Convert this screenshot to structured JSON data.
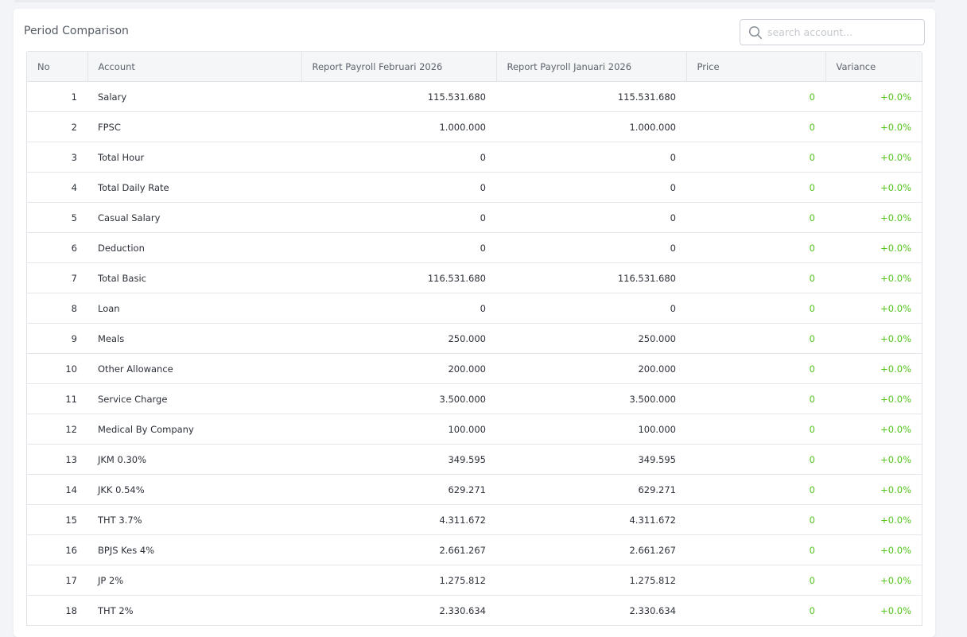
{
  "card": {
    "title": "Period Comparison"
  },
  "search": {
    "placeholder": "search account..."
  },
  "table": {
    "headers": {
      "no": "No",
      "account": "Account",
      "period_a": "Report Payroll Februari 2026",
      "period_b": "Report Payroll Januari 2026",
      "price": "Price",
      "variance": "Variance"
    },
    "rows": [
      {
        "no": "1",
        "account": "Salary",
        "period_a": "115.531.680",
        "period_b": "115.531.680",
        "price": "0",
        "variance": "+0.0%"
      },
      {
        "no": "2",
        "account": "FPSC",
        "period_a": "1.000.000",
        "period_b": "1.000.000",
        "price": "0",
        "variance": "+0.0%"
      },
      {
        "no": "3",
        "account": "Total Hour",
        "period_a": "0",
        "period_b": "0",
        "price": "0",
        "variance": "+0.0%"
      },
      {
        "no": "4",
        "account": "Total Daily Rate",
        "period_a": "0",
        "period_b": "0",
        "price": "0",
        "variance": "+0.0%"
      },
      {
        "no": "5",
        "account": "Casual Salary",
        "period_a": "0",
        "period_b": "0",
        "price": "0",
        "variance": "+0.0%"
      },
      {
        "no": "6",
        "account": "Deduction",
        "period_a": "0",
        "period_b": "0",
        "price": "0",
        "variance": "+0.0%"
      },
      {
        "no": "7",
        "account": "Total Basic",
        "period_a": "116.531.680",
        "period_b": "116.531.680",
        "price": "0",
        "variance": "+0.0%"
      },
      {
        "no": "8",
        "account": "Loan",
        "period_a": "0",
        "period_b": "0",
        "price": "0",
        "variance": "+0.0%"
      },
      {
        "no": "9",
        "account": "Meals",
        "period_a": "250.000",
        "period_b": "250.000",
        "price": "0",
        "variance": "+0.0%"
      },
      {
        "no": "10",
        "account": "Other Allowance",
        "period_a": "200.000",
        "period_b": "200.000",
        "price": "0",
        "variance": "+0.0%"
      },
      {
        "no": "11",
        "account": "Service Charge",
        "period_a": "3.500.000",
        "period_b": "3.500.000",
        "price": "0",
        "variance": "+0.0%"
      },
      {
        "no": "12",
        "account": "Medical By Company",
        "period_a": "100.000",
        "period_b": "100.000",
        "price": "0",
        "variance": "+0.0%"
      },
      {
        "no": "13",
        "account": "JKM 0.30%",
        "period_a": "349.595",
        "period_b": "349.595",
        "price": "0",
        "variance": "+0.0%"
      },
      {
        "no": "14",
        "account": "JKK 0.54%",
        "period_a": "629.271",
        "period_b": "629.271",
        "price": "0",
        "variance": "+0.0%"
      },
      {
        "no": "15",
        "account": "THT 3.7%",
        "period_a": "4.311.672",
        "period_b": "4.311.672",
        "price": "0",
        "variance": "+0.0%"
      },
      {
        "no": "16",
        "account": "BPJS Kes 4%",
        "period_a": "2.661.267",
        "period_b": "2.661.267",
        "price": "0",
        "variance": "+0.0%"
      },
      {
        "no": "17",
        "account": "JP 2%",
        "period_a": "1.275.812",
        "period_b": "1.275.812",
        "price": "0",
        "variance": "+0.0%"
      },
      {
        "no": "18",
        "account": "THT 2%",
        "period_a": "2.330.634",
        "period_b": "2.330.634",
        "price": "0",
        "variance": "+0.0%"
      }
    ]
  },
  "colors": {
    "positive": "#52c41a",
    "header_bg": "#f5f6f8",
    "page_bg": "#f2f4f8"
  },
  "icons": {
    "search": "search-icon"
  }
}
